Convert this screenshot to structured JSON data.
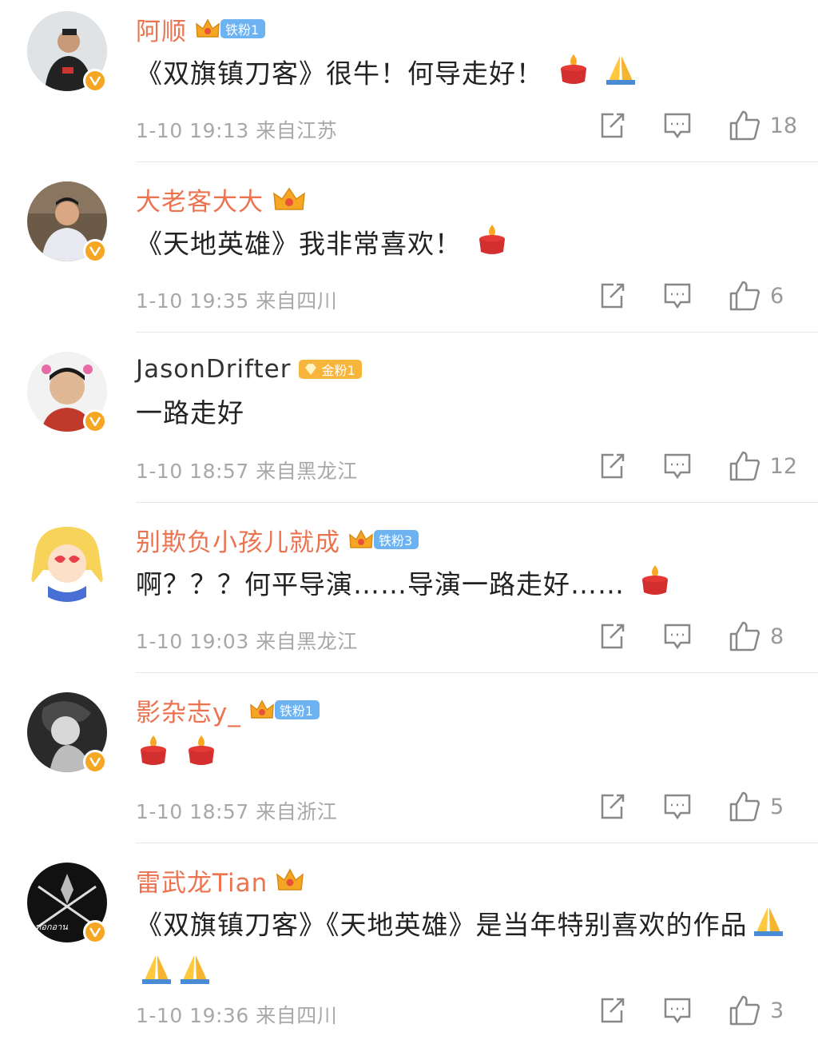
{
  "comments": [
    {
      "name": "阿顺",
      "badge": "铁粉1",
      "badge_kind": "iron",
      "text": "《双旗镇刀客》很牛！何导走好！",
      "time": "1-10 19:13",
      "location": "来自江苏",
      "likes": "18",
      "emoji": [
        "candle",
        "pray"
      ]
    },
    {
      "name": "大老客大大",
      "badge": "",
      "badge_kind": "crown",
      "text": "《天地英雄》我非常喜欢！",
      "time": "1-10 19:35",
      "location": "来自四川",
      "likes": "6",
      "emoji": [
        "candle"
      ]
    },
    {
      "name": "JasonDrifter",
      "badge": "金粉1",
      "badge_kind": "gold",
      "text": "一路走好",
      "time": "1-10 18:57",
      "location": "来自黑龙江",
      "likes": "12",
      "emoji": []
    },
    {
      "name": "别欺负小孩儿就成",
      "badge": "铁粉3",
      "badge_kind": "iron",
      "text": "啊？？？何平导演……导演一路走好……",
      "time": "1-10 19:03",
      "location": "来自黑龙江",
      "likes": "8",
      "emoji": [
        "candle"
      ]
    },
    {
      "name": "影杂志y_",
      "badge": "铁粉1",
      "badge_kind": "iron",
      "text": "",
      "time": "1-10 18:57",
      "location": "来自浙江",
      "likes": "5",
      "emoji": [
        "candle",
        "candle"
      ]
    },
    {
      "name": "雷武龙Tian",
      "badge": "",
      "badge_kind": "crown",
      "text": "《双旗镇刀客》《天地英雄》是当年特别喜欢的作品",
      "time": "1-10 19:36",
      "location": "来自四川",
      "likes": "3",
      "emoji": [
        "pray",
        "pray",
        "pray"
      ]
    }
  ],
  "colors": {
    "name": "#eb7350",
    "meta": "#a8a8a8",
    "badge_iron": "#6db3f2",
    "badge_gold": "#f7b53b",
    "verified": "#f5a623"
  },
  "icons": [
    "share-icon",
    "comment-icon",
    "like-icon",
    "verified-icon",
    "crown-icon",
    "candle-emoji",
    "pray-emoji"
  ]
}
